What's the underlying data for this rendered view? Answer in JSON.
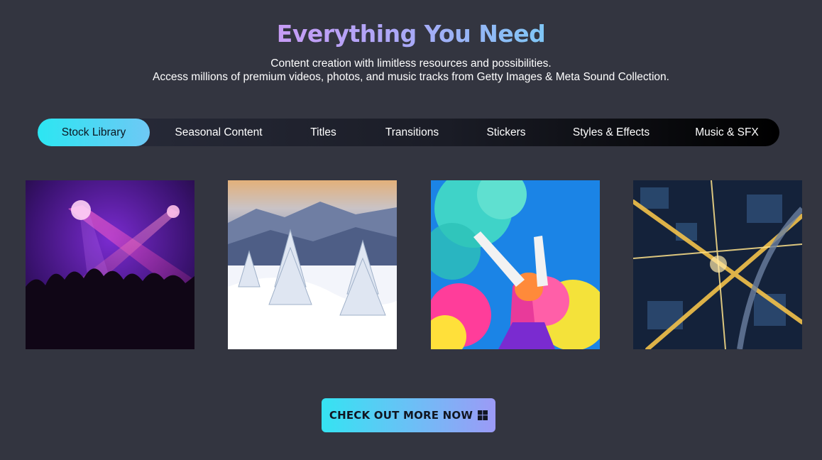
{
  "header": {
    "title": "Everything You Need",
    "subtitle_line1": "Content creation with limitless resources and possibilities.",
    "subtitle_line2": "Access millions of premium videos, photos, and music tracks from Getty Images & Meta Sound Collection."
  },
  "tabs": [
    {
      "label": "Stock Library",
      "active": true
    },
    {
      "label": "Seasonal Content",
      "active": false
    },
    {
      "label": "Titles",
      "active": false
    },
    {
      "label": "Transitions",
      "active": false
    },
    {
      "label": "Stickers",
      "active": false
    },
    {
      "label": "Styles & Effects",
      "active": false
    },
    {
      "label": "Music & SFX",
      "active": false
    }
  ],
  "gallery": [
    {
      "subject": "concert-crowd-lights-image"
    },
    {
      "subject": "snowy-mountain-landscape-image"
    },
    {
      "subject": "color-powder-festival-image"
    },
    {
      "subject": "aerial-city-night-image"
    }
  ],
  "cta": {
    "label": "CHECK OUT MORE NOW",
    "icon": "windows-icon"
  },
  "colors": {
    "background": "#333540",
    "title_gradient_start": "#c79bf5",
    "title_gradient_end": "#7fc6f5",
    "accent_cyan": "#2ce6f2",
    "cta_gradient_end": "#9c9af6"
  }
}
